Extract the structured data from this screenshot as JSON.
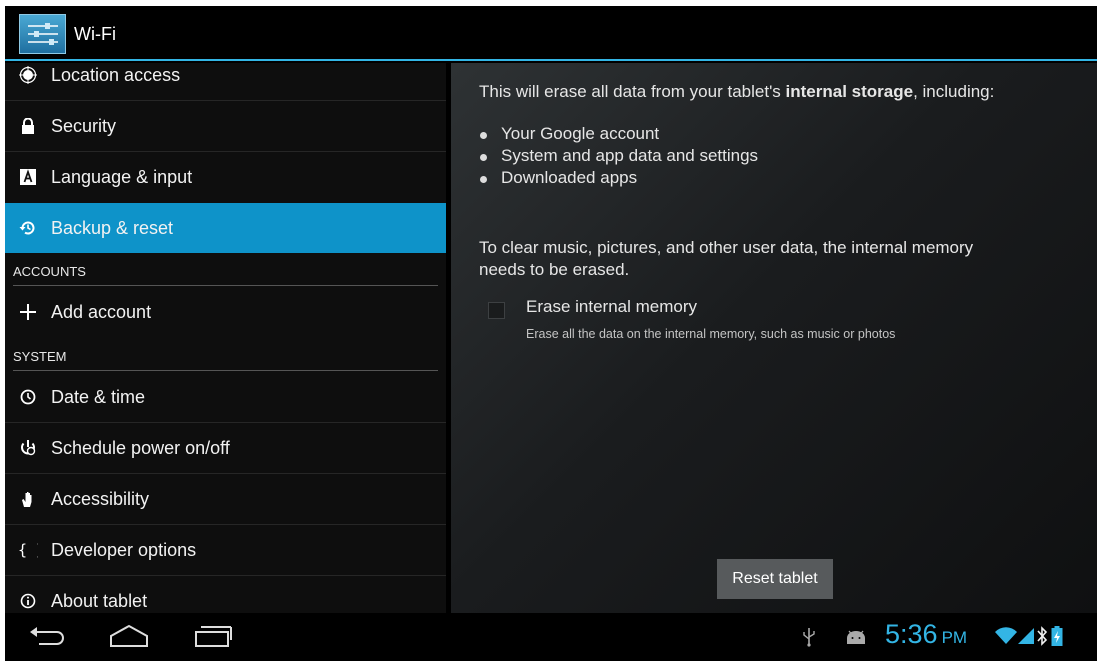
{
  "action_bar": {
    "title": "Wi-Fi",
    "icon": "settings-sliders-icon"
  },
  "sidebar": {
    "items": [
      {
        "label": "Location access",
        "icon": "location-target-icon"
      },
      {
        "label": "Security",
        "icon": "lock-icon"
      },
      {
        "label": "Language & input",
        "icon": "keyboard-a-icon"
      },
      {
        "label": "Backup & reset",
        "icon": "backup-restore-icon",
        "selected": true
      }
    ],
    "accounts_header": "ACCOUNTS",
    "add_account": {
      "label": "Add account",
      "icon": "plus-icon"
    },
    "system_header": "SYSTEM",
    "system_items": [
      {
        "label": "Date & time",
        "icon": "clock-icon"
      },
      {
        "label": "Schedule power on/off",
        "icon": "power-schedule-icon"
      },
      {
        "label": "Accessibility",
        "icon": "hand-icon"
      },
      {
        "label": "Developer options",
        "icon": "braces-icon"
      },
      {
        "label": "About tablet",
        "icon": "info-icon"
      }
    ]
  },
  "content": {
    "intro_prefix": "This will erase all data from your tablet's ",
    "intro_bold": "internal storage",
    "intro_suffix": ", including:",
    "bullets": [
      "Your Google account",
      "System and app data and settings",
      "Downloaded apps"
    ],
    "clear_note_line1": "To clear music, pictures, and other user data, the internal memory",
    "clear_note_line2": "needs to be erased.",
    "erase_option": {
      "title": "Erase internal memory",
      "summary": "Erase all the data on the internal memory, such as music or photos",
      "checked": false
    },
    "reset_button": "Reset tablet"
  },
  "nav_bar": {
    "buttons": [
      "back-icon",
      "home-icon",
      "recent-apps-icon"
    ],
    "status_icons": [
      "usb-icon",
      "android-debug-icon",
      "wifi-icon",
      "signal-icon",
      "bluetooth-icon",
      "battery-icon"
    ],
    "time": "5:36",
    "ampm": "PM"
  },
  "colors": {
    "accent": "#33b5e5",
    "selected": "#0e93c9",
    "background": "#000000"
  }
}
